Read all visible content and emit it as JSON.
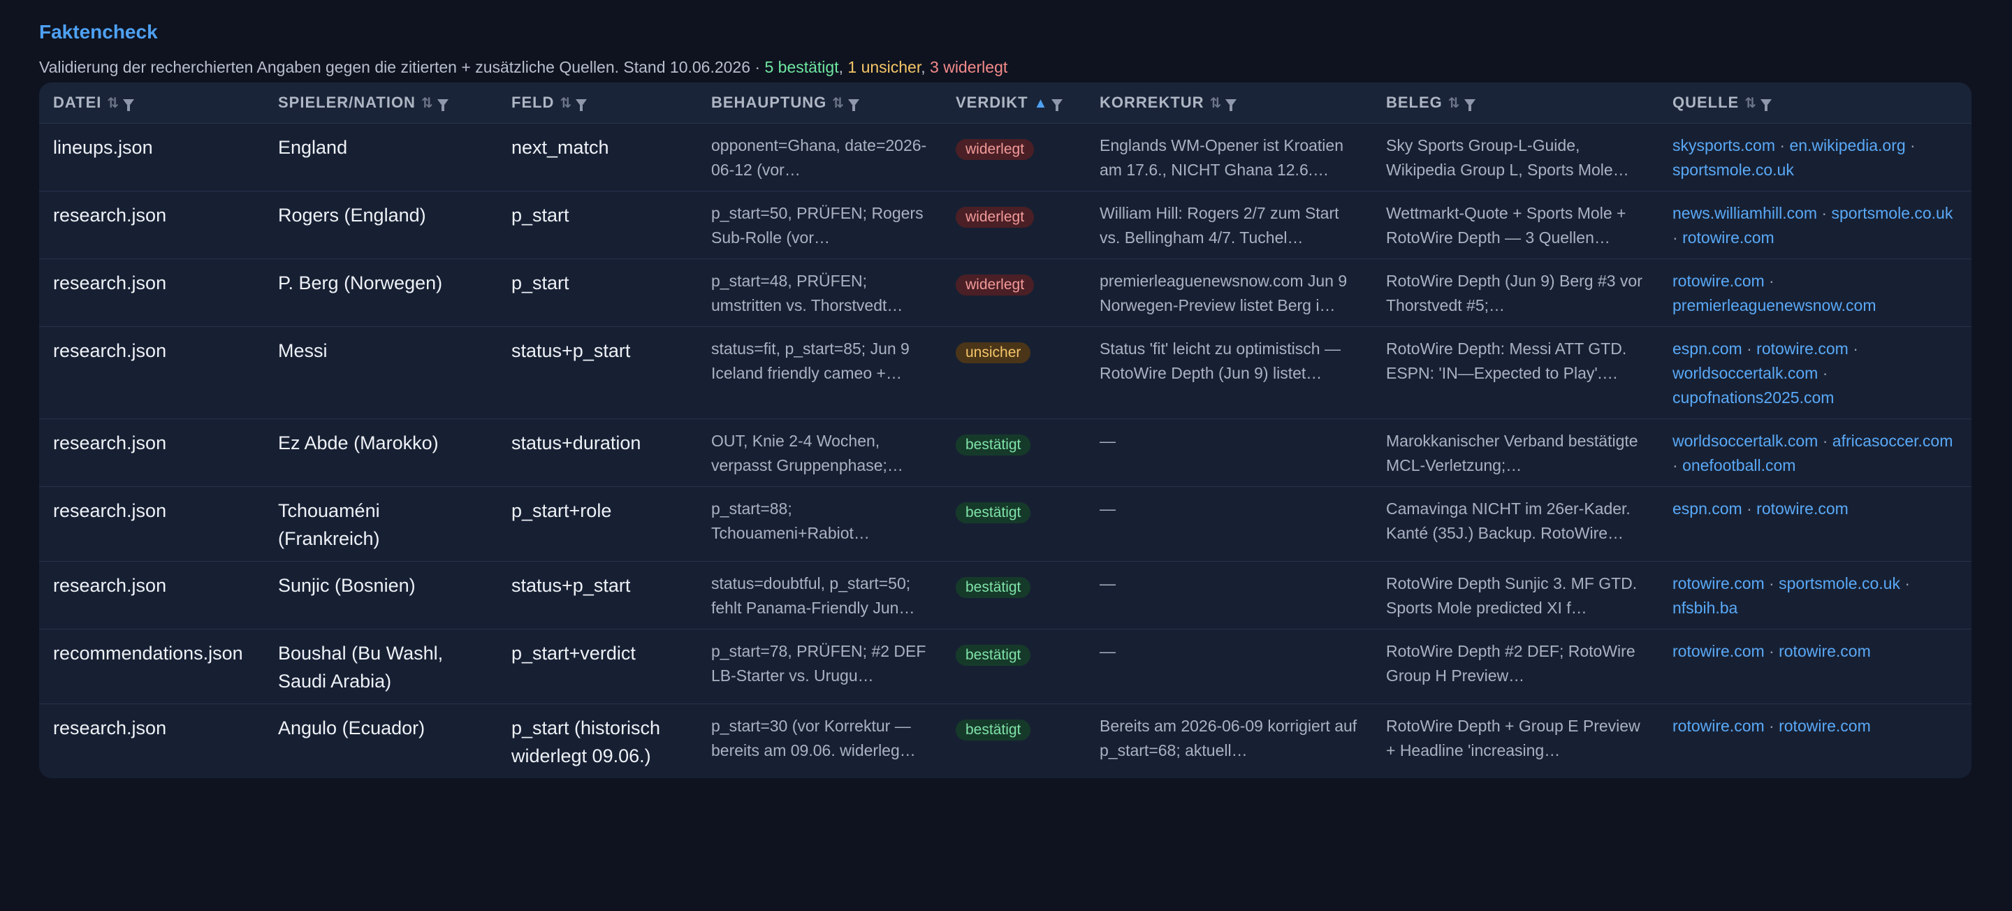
{
  "header": {
    "title": "Faktencheck",
    "subtitle": "Validierung der recherchierten Angaben gegen die zitierten + zusätzliche Quellen. Stand 10.06.2026 · ",
    "count_ok": "5 bestätigt",
    "sep1": ", ",
    "count_unsure": "1 unsicher",
    "sep2": ", ",
    "count_refuted": "3 widerlegt"
  },
  "columns": [
    {
      "label": "DATEI",
      "sort": "⇅"
    },
    {
      "label": "SPIELER/NATION",
      "sort": "⇅"
    },
    {
      "label": "FELD",
      "sort": "⇅"
    },
    {
      "label": "BEHAUPTUNG",
      "sort": "⇅"
    },
    {
      "label": "VERDIKT",
      "sort": "▲"
    },
    {
      "label": "KORREKTUR",
      "sort": "⇅"
    },
    {
      "label": "BELEG",
      "sort": "⇅"
    },
    {
      "label": "QUELLE",
      "sort": "⇅"
    }
  ],
  "rows": [
    {
      "datei": "lineups.json",
      "spieler": "England",
      "feld": "next_match",
      "behauptung": "opponent=Ghana, date=2026-06-12 (vor…",
      "verdikt": "widerlegt",
      "type": "bad",
      "korrektur": "Englands WM-Opener ist Kroatien am 17.6., NICHT Ghana 12.6.…",
      "beleg": "Sky Sports Group-L-Guide, Wikipedia Group L, Sports Mole…",
      "quellen": [
        "skysports.com",
        "en.wikipedia.org",
        "sportsmole.co.uk"
      ]
    },
    {
      "datei": "research.json",
      "spieler": "Rogers (England)",
      "feld": "p_start",
      "behauptung": "p_start=50, PRÜFEN; Rogers Sub-Rolle (vor…",
      "verdikt": "widerlegt",
      "type": "bad",
      "korrektur": "William Hill: Rogers 2/7 zum Start vs. Bellingham 4/7. Tuchel…",
      "beleg": "Wettmarkt-Quote + Sports Mole + RotoWire Depth — 3 Quellen…",
      "quellen": [
        "news.williamhill.com",
        "sportsmole.co.uk",
        "rotowire.com"
      ]
    },
    {
      "datei": "research.json",
      "spieler": "P. Berg (Norwegen)",
      "feld": "p_start",
      "behauptung": "p_start=48, PRÜFEN; umstritten vs. Thorstvedt…",
      "verdikt": "widerlegt",
      "type": "bad",
      "korrektur": "premierleaguenewsnow.com Jun 9 Norwegen-Preview listet Berg i…",
      "beleg": "RotoWire Depth (Jun 9) Berg #3 vor Thorstvedt #5;…",
      "quellen": [
        "rotowire.com",
        "premierleaguenewsnow.com"
      ]
    },
    {
      "datei": "research.json",
      "spieler": "Messi",
      "feld": "status+p_start",
      "behauptung": "status=fit, p_start=85; Jun 9 Iceland friendly cameo +…",
      "verdikt": "unsicher",
      "type": "uns",
      "korrektur": "Status 'fit' leicht zu optimistisch — RotoWire Depth (Jun 9) listet…",
      "beleg": "RotoWire Depth: Messi ATT GTD. ESPN: 'IN—Expected to Play'.…",
      "quellen": [
        "espn.com",
        "rotowire.com",
        "worldsoccertalk.com",
        "cupofnations2025.com"
      ]
    },
    {
      "datei": "research.json",
      "spieler": "Ez Abde (Marokko)",
      "feld": "status+duration",
      "behauptung": "OUT, Knie 2-4 Wochen, verpasst Gruppenphase;…",
      "verdikt": "bestätigt",
      "type": "ok",
      "korrektur": "—",
      "beleg": "Marokkanischer Verband bestätigte MCL-Verletzung;…",
      "quellen": [
        "worldsoccertalk.com",
        "africasoccer.com",
        "onefootball.com"
      ]
    },
    {
      "datei": "research.json",
      "spieler": "Tchouaméni (Frankreich)",
      "feld": "p_start+role",
      "behauptung": "p_start=88; Tchouameni+Rabiot…",
      "verdikt": "bestätigt",
      "type": "ok",
      "korrektur": "—",
      "beleg": "Camavinga NICHT im 26er-Kader. Kanté (35J.) Backup. RotoWire…",
      "quellen": [
        "espn.com",
        "rotowire.com"
      ]
    },
    {
      "datei": "research.json",
      "spieler": "Sunjic (Bosnien)",
      "feld": "status+p_start",
      "behauptung": "status=doubtful, p_start=50; fehlt Panama-Friendly Jun…",
      "verdikt": "bestätigt",
      "type": "ok",
      "korrektur": "—",
      "beleg": "RotoWire Depth Sunjic 3. MF GTD. Sports Mole predicted XI f…",
      "quellen": [
        "rotowire.com",
        "sportsmole.co.uk",
        "nfsbih.ba"
      ]
    },
    {
      "datei": "recommendations.json",
      "spieler": "Boushal (Bu Washl, Saudi Arabia)",
      "feld": "p_start+verdict",
      "behauptung": "p_start=78, PRÜFEN; #2 DEF LB-Starter vs. Urugu…",
      "verdikt": "bestätigt",
      "type": "ok",
      "korrektur": "—",
      "beleg": "RotoWire Depth #2 DEF; RotoWire Group H Preview…",
      "quellen": [
        "rotowire.com",
        "rotowire.com"
      ]
    },
    {
      "datei": "research.json",
      "spieler": "Angulo (Ecuador)",
      "feld": "p_start (historisch widerlegt 09.06.)",
      "behauptung": "p_start=30 (vor Korrektur — bereits am 09.06. widerleg…",
      "verdikt": "bestätigt",
      "type": "ok",
      "korrektur": "Bereits am 2026-06-09 korrigiert auf p_start=68; aktuell…",
      "beleg": "RotoWire Depth + Group E Preview + Headline 'increasing…",
      "quellen": [
        "rotowire.com",
        "rotowire.com"
      ]
    }
  ]
}
